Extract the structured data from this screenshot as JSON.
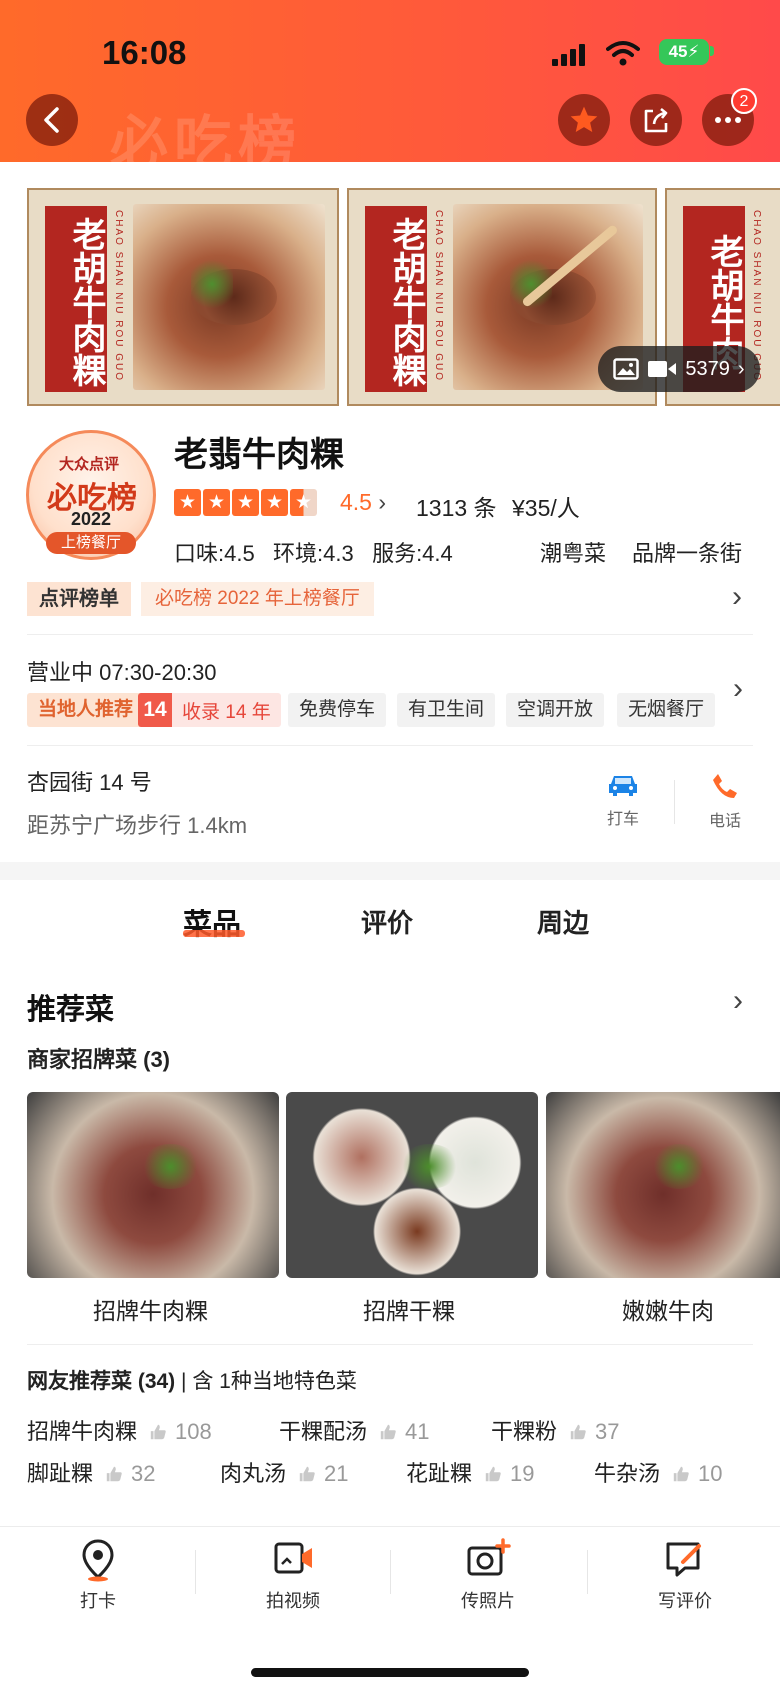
{
  "status_bar": {
    "time": "16:08",
    "battery": "45"
  },
  "header": {
    "watermark": "必吃榜",
    "badge_count": "2"
  },
  "gallery": {
    "banners": [
      {
        "label": "老胡牛肉粿",
        "pinyin": "CHAO SHAN NIU ROU GUO"
      },
      {
        "label": "老胡牛肉粿",
        "pinyin": "CHAO SHAN NIU ROU GUO"
      },
      {
        "label": "老胡牛肉",
        "pinyin": "CHAO SHAN NIU ROU GUO"
      }
    ],
    "media_count": "5379"
  },
  "restaurant": {
    "logo": {
      "line1": "大众点评",
      "line2": "必吃榜",
      "line3": "2022",
      "line4": "上榜餐厅"
    },
    "name": "老翡牛肉粿",
    "rating": "4.5",
    "rating_stars": 4.5,
    "review_count": "1313 条",
    "price": "¥35/人",
    "scores": "口味:4.5   环境:4.3   服务:4.4",
    "category": "潮粤菜",
    "area": "品牌一条街"
  },
  "ranking": {
    "label": "点评榜单",
    "text": "必吃榜 2022 年上榜餐厅"
  },
  "business": {
    "status": "营业中 07:30-20:30",
    "local_tag": "当地人推荐",
    "years_num": "14",
    "years_text": "收录 14 年",
    "tags": [
      "免费停车",
      "有卫生间",
      "空调开放",
      "无烟餐厅"
    ]
  },
  "address": {
    "street": "杏园街 14 号",
    "distance": "距苏宁广场步行 1.4km",
    "taxi_label": "打车",
    "phone_label": "电话"
  },
  "tabs": [
    {
      "label": "菜品",
      "active": true
    },
    {
      "label": "评价",
      "active": false
    },
    {
      "label": "周边",
      "active": false
    }
  ],
  "dishes": {
    "section_title": "推荐菜",
    "signature_title": "商家招牌菜 (3)",
    "signature": [
      {
        "name": "招牌牛肉粿"
      },
      {
        "name": "招牌干粿"
      },
      {
        "name": "嫩嫩牛肉"
      }
    ],
    "user_title": "网友推荐菜 (34)",
    "user_subtitle": "| 含 1种当地特色菜",
    "user_recommended": [
      {
        "name": "招牌牛肉粿",
        "likes": "108"
      },
      {
        "name": "干粿配汤",
        "likes": "41"
      },
      {
        "name": "干粿粉",
        "likes": "37"
      },
      {
        "name": "脚趾粿",
        "likes": "32"
      },
      {
        "name": "肉丸汤",
        "likes": "21"
      },
      {
        "name": "花趾粿",
        "likes": "19"
      },
      {
        "name": "牛杂汤",
        "likes": "10"
      }
    ]
  },
  "bottom_nav": [
    {
      "label": "打卡"
    },
    {
      "label": "拍视频"
    },
    {
      "label": "传照片"
    },
    {
      "label": "写评价"
    }
  ],
  "colors": {
    "accent": "#ff6a2a",
    "brand_red": "#b32620",
    "tab_underline": "#ff5a2a"
  }
}
